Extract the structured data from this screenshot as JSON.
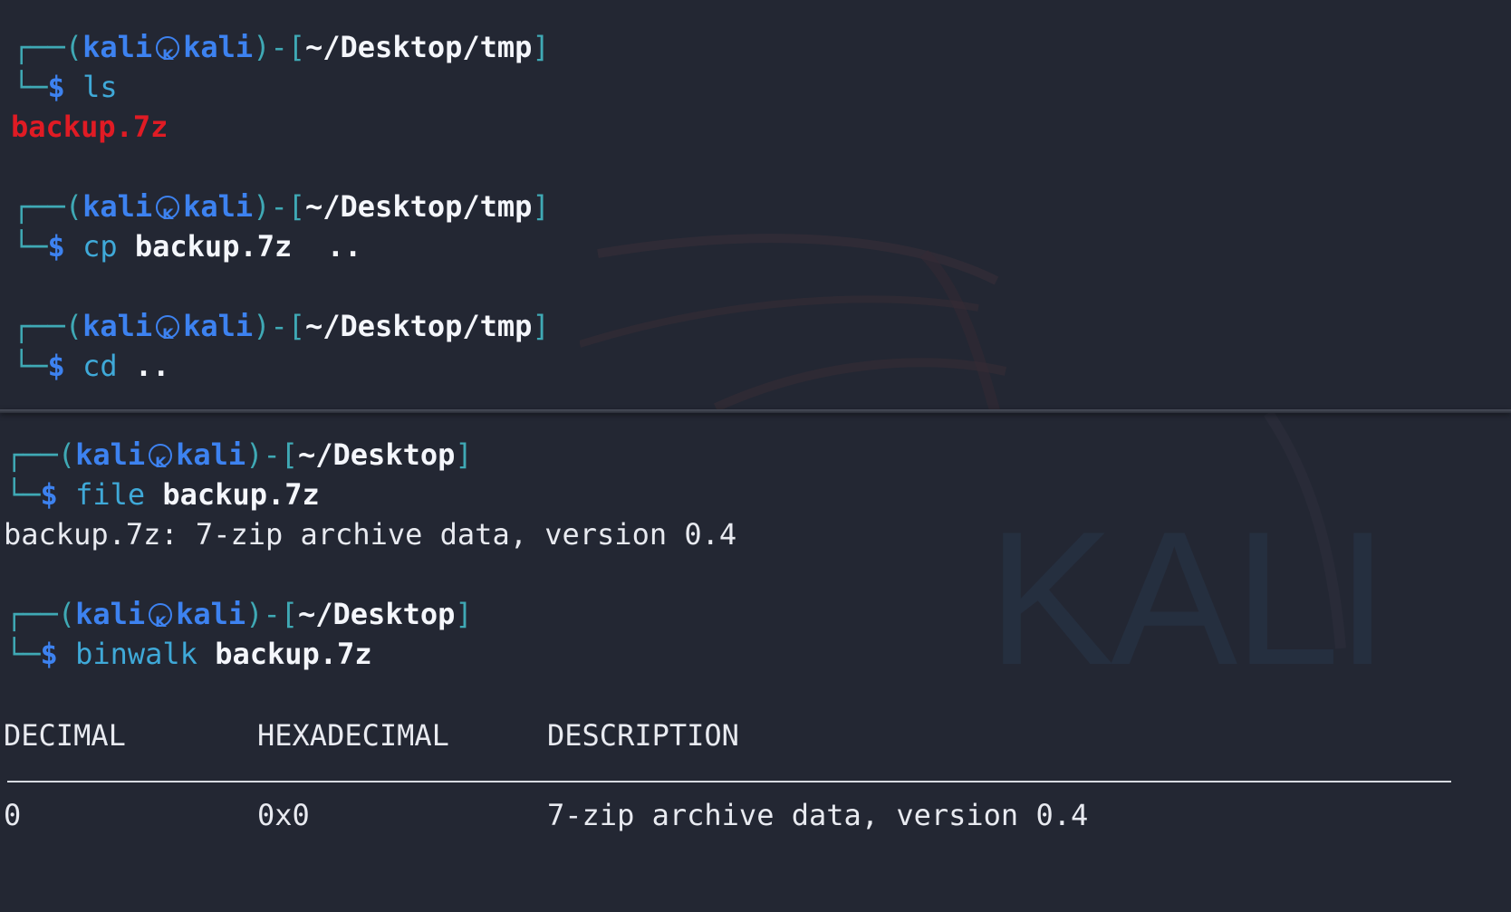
{
  "prompt": {
    "user": "kali",
    "host": "kali",
    "skull_icon": "kali-skull-icon",
    "dollar": "$"
  },
  "top_pane": {
    "blocks": [
      {
        "path": "~/Desktop/tmp",
        "command": "ls",
        "args": "",
        "output": "backup.7z"
      },
      {
        "path": "~/Desktop/tmp",
        "command": "cp",
        "args": "backup.7z",
        "args2": "..",
        "output": ""
      },
      {
        "path": "~/Desktop/tmp",
        "command": "cd",
        "args": "..",
        "output": ""
      }
    ]
  },
  "bottom_pane": {
    "blocks": [
      {
        "path": "~/Desktop",
        "command": "file",
        "args": "backup.7z",
        "output": "backup.7z: 7-zip archive data, version 0.4"
      },
      {
        "path": "~/Desktop",
        "command": "binwalk",
        "args": "backup.7z"
      }
    ],
    "binwalk_table": {
      "headers": [
        "DECIMAL",
        "HEXADECIMAL",
        "DESCRIPTION"
      ],
      "rows": [
        [
          "0",
          "0x0",
          "7-zip archive data, version 0.4"
        ]
      ]
    },
    "watermark": "KALI"
  },
  "colors": {
    "background": "#232733",
    "tree": "#3fa9b5",
    "user": "#3d82f0",
    "command": "#3fa9d8",
    "error_file": "#e01b24",
    "text": "#e8eaf0"
  }
}
